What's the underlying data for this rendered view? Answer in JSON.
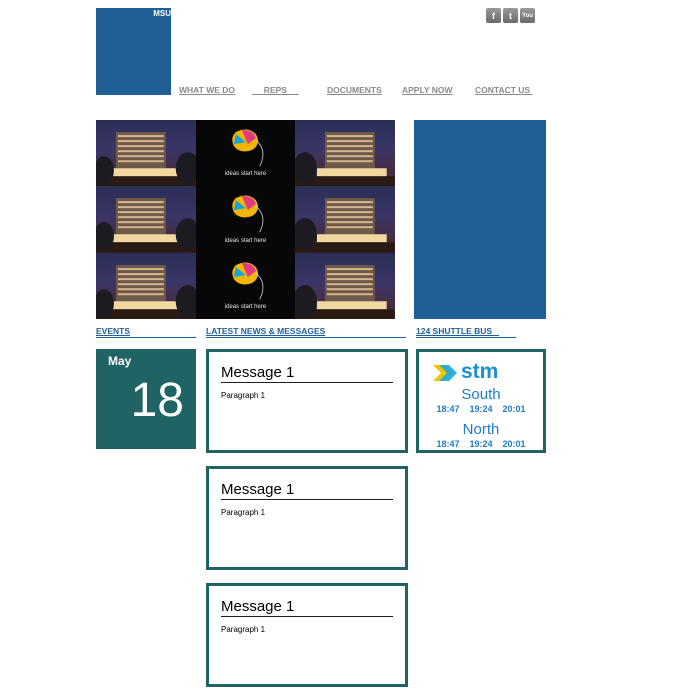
{
  "logo": {
    "text": "MSU"
  },
  "social": [
    {
      "icon": "facebook-icon",
      "glyph": "f"
    },
    {
      "icon": "twitter-icon",
      "glyph": "t"
    },
    {
      "icon": "youtube-icon",
      "glyph": "You"
    }
  ],
  "nav": {
    "items": [
      {
        "label": "WHAT WE DO"
      },
      {
        "label": "     REPS     "
      },
      {
        "label": "DOCUMENTS"
      },
      {
        "label": "APPLY NOW"
      },
      {
        "label": "CONTACT US "
      }
    ]
  },
  "hero": {
    "tagline": "ideas start here"
  },
  "sections": {
    "events": "EVENTS",
    "news": "LATEST NEWS & MESSAGES",
    "shuttle": "124 SHUTTLE BUS   "
  },
  "event": {
    "month": "May",
    "day": "18"
  },
  "messages": [
    {
      "title": "Message 1",
      "body": "Paragraph 1"
    },
    {
      "title": "Message 1",
      "body": "Paragraph 1"
    },
    {
      "title": "Message 1",
      "body": "Paragraph 1"
    }
  ],
  "shuttle": {
    "brand": "stm",
    "south": {
      "label": "South",
      "times": [
        "18:47",
        "19:24",
        "20:01"
      ]
    },
    "north": {
      "label": "North",
      "times": [
        "18:47",
        "19:24",
        "20:01"
      ]
    }
  },
  "colors": {
    "primary_blue": "#1f5f96",
    "teal": "#1f6364",
    "nav_gray": "#8a8a8a",
    "stm_blue": "#1a8fd6"
  }
}
